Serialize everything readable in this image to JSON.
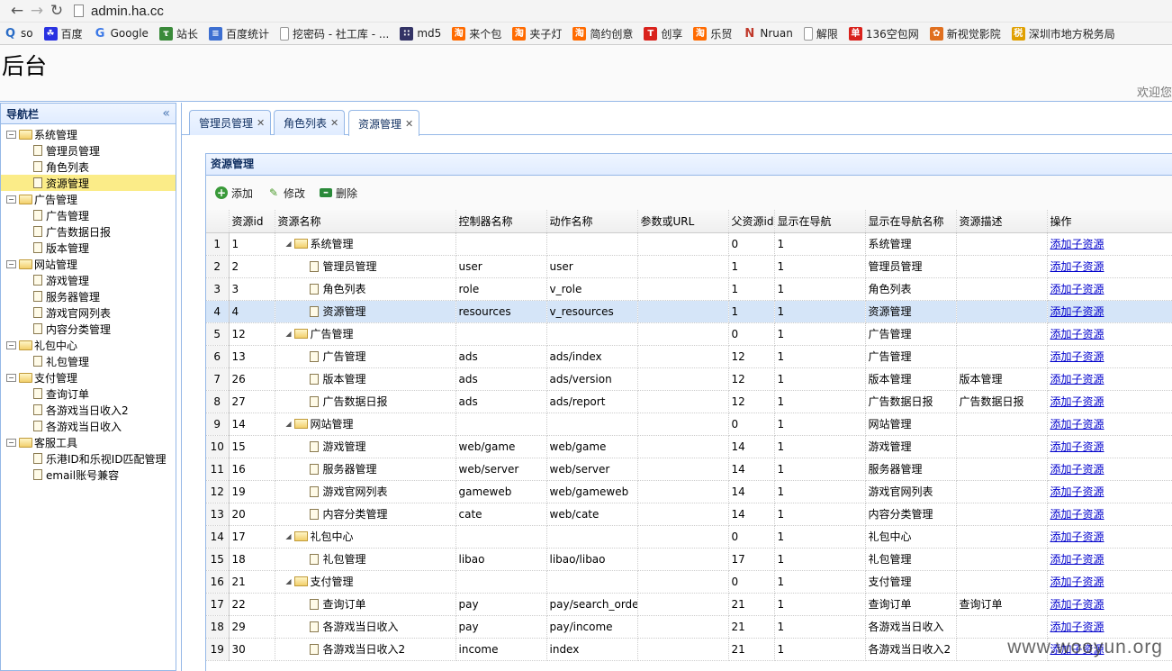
{
  "browser": {
    "url": "admin.ha.cc",
    "bookmarks": [
      {
        "label": "so",
        "icon": "search-icon",
        "color": "#2a6cc6"
      },
      {
        "label": "百度",
        "icon": "paw-icon",
        "color": "#2932e1"
      },
      {
        "label": "Google",
        "icon": "google-icon",
        "color": "#3b78e7"
      },
      {
        "label": "站长",
        "icon": "site-icon",
        "color": "#3a8a3a"
      },
      {
        "label": "百度统计",
        "icon": "stats-icon",
        "color": "#3d6fd1"
      },
      {
        "label": "挖密码 - 社工库 - ...",
        "icon": "page-icon",
        "color": "#999999"
      },
      {
        "label": "md5",
        "icon": "grid-icon",
        "color": "#333366"
      },
      {
        "label": "来个包",
        "icon": "taobao-icon",
        "color": "#ff6a00"
      },
      {
        "label": "夹子灯",
        "icon": "taobao-icon",
        "color": "#ff6a00"
      },
      {
        "label": "简约创意",
        "icon": "taobao-icon",
        "color": "#ff6a00"
      },
      {
        "label": "创享",
        "icon": "t-icon",
        "color": "#d9221c"
      },
      {
        "label": "乐贸",
        "icon": "taobao-icon",
        "color": "#ff6a00"
      },
      {
        "label": "Nruan",
        "icon": "n-icon",
        "color": "#c0392b"
      },
      {
        "label": "解限",
        "icon": "page-icon",
        "color": "#999999"
      },
      {
        "label": "136空包网",
        "icon": "dan-icon",
        "color": "#d9221c"
      },
      {
        "label": "新视觉影院",
        "icon": "flower-icon",
        "color": "#e07020"
      },
      {
        "label": "深圳市地方税务局",
        "icon": "tax-icon",
        "color": "#e0a000"
      }
    ]
  },
  "header": {
    "title": "后台",
    "welcome": "欢迎您"
  },
  "sidebar": {
    "title": "导航栏",
    "groups": [
      {
        "label": "系统管理",
        "items": [
          "管理员管理",
          "角色列表",
          "资源管理"
        ]
      },
      {
        "label": "广告管理",
        "items": [
          "广告管理",
          "广告数据日报",
          "版本管理"
        ]
      },
      {
        "label": "网站管理",
        "items": [
          "游戏管理",
          "服务器管理",
          "游戏官网列表",
          "内容分类管理"
        ]
      },
      {
        "label": "礼包中心",
        "items": [
          "礼包管理"
        ]
      },
      {
        "label": "支付管理",
        "items": [
          "查询订单",
          "各游戏当日收入2",
          "各游戏当日收入"
        ]
      },
      {
        "label": "客服工具",
        "items": [
          "乐港ID和乐视ID匹配管理",
          "email账号兼容"
        ]
      }
    ],
    "selected": "资源管理"
  },
  "tabs": [
    {
      "label": "管理员管理",
      "active": false
    },
    {
      "label": "角色列表",
      "active": false
    },
    {
      "label": "资源管理",
      "active": true
    }
  ],
  "panel": {
    "title": "资源管理",
    "toolbar": {
      "add": "添加",
      "edit": "修改",
      "delete": "删除"
    },
    "columns": [
      "资源id",
      "资源名称",
      "控制器名称",
      "动作名称",
      "参数或URL",
      "父资源id",
      "显示在导航",
      "显示在导航名称",
      "资源描述",
      "操作"
    ],
    "rows": [
      {
        "n": "1",
        "id": "1",
        "name": "系统管理",
        "folder": true,
        "ctrl": "",
        "action": "",
        "param": "",
        "pid": "0",
        "nav": "1",
        "nav_name": "系统管理",
        "desc": "",
        "op": "添加子资源"
      },
      {
        "n": "2",
        "id": "2",
        "name": "管理员管理",
        "folder": false,
        "ctrl": "user",
        "action": "user",
        "param": "",
        "pid": "1",
        "nav": "1",
        "nav_name": "管理员管理",
        "desc": "",
        "op": "添加子资源"
      },
      {
        "n": "3",
        "id": "3",
        "name": "角色列表",
        "folder": false,
        "ctrl": "role",
        "action": "v_role",
        "param": "",
        "pid": "1",
        "nav": "1",
        "nav_name": "角色列表",
        "desc": "",
        "op": "添加子资源"
      },
      {
        "n": "4",
        "id": "4",
        "name": "资源管理",
        "folder": false,
        "ctrl": "resources",
        "action": "v_resources",
        "param": "",
        "pid": "1",
        "nav": "1",
        "nav_name": "资源管理",
        "desc": "",
        "op": "添加子资源",
        "selected": true
      },
      {
        "n": "5",
        "id": "12",
        "name": "广告管理",
        "folder": true,
        "ctrl": "",
        "action": "",
        "param": "",
        "pid": "0",
        "nav": "1",
        "nav_name": "广告管理",
        "desc": "",
        "op": "添加子资源"
      },
      {
        "n": "6",
        "id": "13",
        "name": "广告管理",
        "folder": false,
        "ctrl": "ads",
        "action": "ads/index",
        "param": "",
        "pid": "12",
        "nav": "1",
        "nav_name": "广告管理",
        "desc": "",
        "op": "添加子资源"
      },
      {
        "n": "7",
        "id": "26",
        "name": "版本管理",
        "folder": false,
        "ctrl": "ads",
        "action": "ads/version",
        "param": "",
        "pid": "12",
        "nav": "1",
        "nav_name": "版本管理",
        "desc": "版本管理",
        "op": "添加子资源"
      },
      {
        "n": "8",
        "id": "27",
        "name": "广告数据日报",
        "folder": false,
        "ctrl": "ads",
        "action": "ads/report",
        "param": "",
        "pid": "12",
        "nav": "1",
        "nav_name": "广告数据日报",
        "desc": "广告数据日报",
        "op": "添加子资源"
      },
      {
        "n": "9",
        "id": "14",
        "name": "网站管理",
        "folder": true,
        "ctrl": "",
        "action": "",
        "param": "",
        "pid": "0",
        "nav": "1",
        "nav_name": "网站管理",
        "desc": "",
        "op": "添加子资源"
      },
      {
        "n": "10",
        "id": "15",
        "name": "游戏管理",
        "folder": false,
        "ctrl": "web/game",
        "action": "web/game",
        "param": "",
        "pid": "14",
        "nav": "1",
        "nav_name": "游戏管理",
        "desc": "",
        "op": "添加子资源"
      },
      {
        "n": "11",
        "id": "16",
        "name": "服务器管理",
        "folder": false,
        "ctrl": "web/server",
        "action": "web/server",
        "param": "",
        "pid": "14",
        "nav": "1",
        "nav_name": "服务器管理",
        "desc": "",
        "op": "添加子资源"
      },
      {
        "n": "12",
        "id": "19",
        "name": "游戏官网列表",
        "folder": false,
        "ctrl": "gameweb",
        "action": "web/gameweb",
        "param": "",
        "pid": "14",
        "nav": "1",
        "nav_name": "游戏官网列表",
        "desc": "",
        "op": "添加子资源"
      },
      {
        "n": "13",
        "id": "20",
        "name": "内容分类管理",
        "folder": false,
        "ctrl": "cate",
        "action": "web/cate",
        "param": "",
        "pid": "14",
        "nav": "1",
        "nav_name": "内容分类管理",
        "desc": "",
        "op": "添加子资源"
      },
      {
        "n": "14",
        "id": "17",
        "name": "礼包中心",
        "folder": true,
        "ctrl": "",
        "action": "",
        "param": "",
        "pid": "0",
        "nav": "1",
        "nav_name": "礼包中心",
        "desc": "",
        "op": "添加子资源"
      },
      {
        "n": "15",
        "id": "18",
        "name": "礼包管理",
        "folder": false,
        "ctrl": "libao",
        "action": "libao/libao",
        "param": "",
        "pid": "17",
        "nav": "1",
        "nav_name": "礼包管理",
        "desc": "",
        "op": "添加子资源"
      },
      {
        "n": "16",
        "id": "21",
        "name": "支付管理",
        "folder": true,
        "ctrl": "",
        "action": "",
        "param": "",
        "pid": "0",
        "nav": "1",
        "nav_name": "支付管理",
        "desc": "",
        "op": "添加子资源"
      },
      {
        "n": "17",
        "id": "22",
        "name": "查询订单",
        "folder": false,
        "ctrl": "pay",
        "action": "pay/search_order",
        "param": "",
        "pid": "21",
        "nav": "1",
        "nav_name": "查询订单",
        "desc": "查询订单",
        "op": "添加子资源"
      },
      {
        "n": "18",
        "id": "29",
        "name": "各游戏当日收入",
        "folder": false,
        "ctrl": "pay",
        "action": "pay/income",
        "param": "",
        "pid": "21",
        "nav": "1",
        "nav_name": "各游戏当日收入",
        "desc": "",
        "op": "添加子资源"
      },
      {
        "n": "19",
        "id": "30",
        "name": "各游戏当日收入2",
        "folder": false,
        "ctrl": "income",
        "action": "index",
        "param": "",
        "pid": "21",
        "nav": "1",
        "nav_name": "各游戏当日收入2",
        "desc": "",
        "op": "添加子资源"
      }
    ]
  },
  "watermark": "www.wooyun.org"
}
